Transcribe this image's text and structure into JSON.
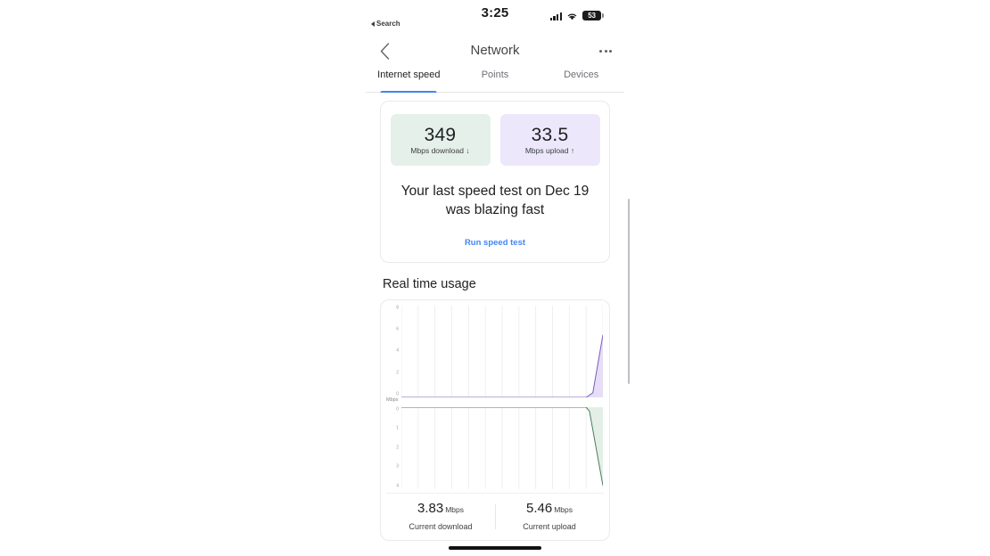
{
  "status_bar": {
    "time": "3:25",
    "back_app_label": "Search",
    "back_arrow_icon": "triangle-left-icon",
    "cellular_icon": "cellular-signal-icon",
    "wifi_icon": "wifi-icon",
    "battery_icon": "battery-icon",
    "battery_percent": "53"
  },
  "nav": {
    "back_icon": "chevron-left-icon",
    "title": "Network",
    "more_icon": "overflow-menu-icon"
  },
  "tabs": [
    {
      "label": "Internet speed",
      "active": true
    },
    {
      "label": "Points",
      "active": false
    },
    {
      "label": "Devices",
      "active": false
    }
  ],
  "speed_card": {
    "download": {
      "value": "349",
      "label": "Mbps download ↓",
      "bg": "#E6F0EA"
    },
    "upload": {
      "value": "33.5",
      "label": "Mbps upload ↑",
      "bg": "#EDE7FB"
    },
    "headline": "Your last speed test on Dec 19 was blazing fast",
    "run_test_label": "Run speed test",
    "link_color": "#4285F4"
  },
  "real_time_usage": {
    "section_title": "Real time usage",
    "axis_unit": "Mbps",
    "stats": [
      {
        "value": "3.83",
        "unit": "Mbps",
        "caption": "Current download"
      },
      {
        "value": "5.46",
        "unit": "Mbps",
        "caption": "Current upload"
      }
    ]
  },
  "chart_data": [
    {
      "type": "area",
      "name": "upload",
      "title": "Real time usage — upload",
      "ylabel": "Mbps",
      "ytick_labels": [
        "8",
        "6",
        "4",
        "2",
        "0"
      ],
      "ylim": [
        0,
        8
      ],
      "grid": true,
      "grid_vertical_count": 12,
      "direction": "up",
      "line_color": "#7B5BBE",
      "fill_color": "#E7DEF6",
      "x": [
        0,
        1,
        2,
        3,
        4,
        5,
        6,
        7,
        8,
        9,
        10,
        11,
        11.4,
        12
      ],
      "values": [
        0,
        0,
        0,
        0,
        0,
        0,
        0,
        0,
        0,
        0,
        0,
        0,
        0.4,
        5.46
      ]
    },
    {
      "type": "area",
      "name": "download",
      "title": "Real time usage — download",
      "ylabel": "Mbps",
      "ytick_labels": [
        "0",
        "1",
        "2",
        "3",
        "4"
      ],
      "ylim": [
        0,
        4
      ],
      "grid": true,
      "grid_vertical_count": 12,
      "direction": "down",
      "line_color": "#4E7C5A",
      "fill_color": "#E3EFE6",
      "x": [
        0,
        1,
        2,
        3,
        4,
        5,
        6,
        7,
        8,
        9,
        10,
        11,
        11.2,
        12
      ],
      "values": [
        0,
        0,
        0,
        0,
        0,
        0,
        0,
        0,
        0,
        0,
        0,
        0,
        0.2,
        3.83
      ]
    }
  ],
  "home_indicator": "home-indicator"
}
